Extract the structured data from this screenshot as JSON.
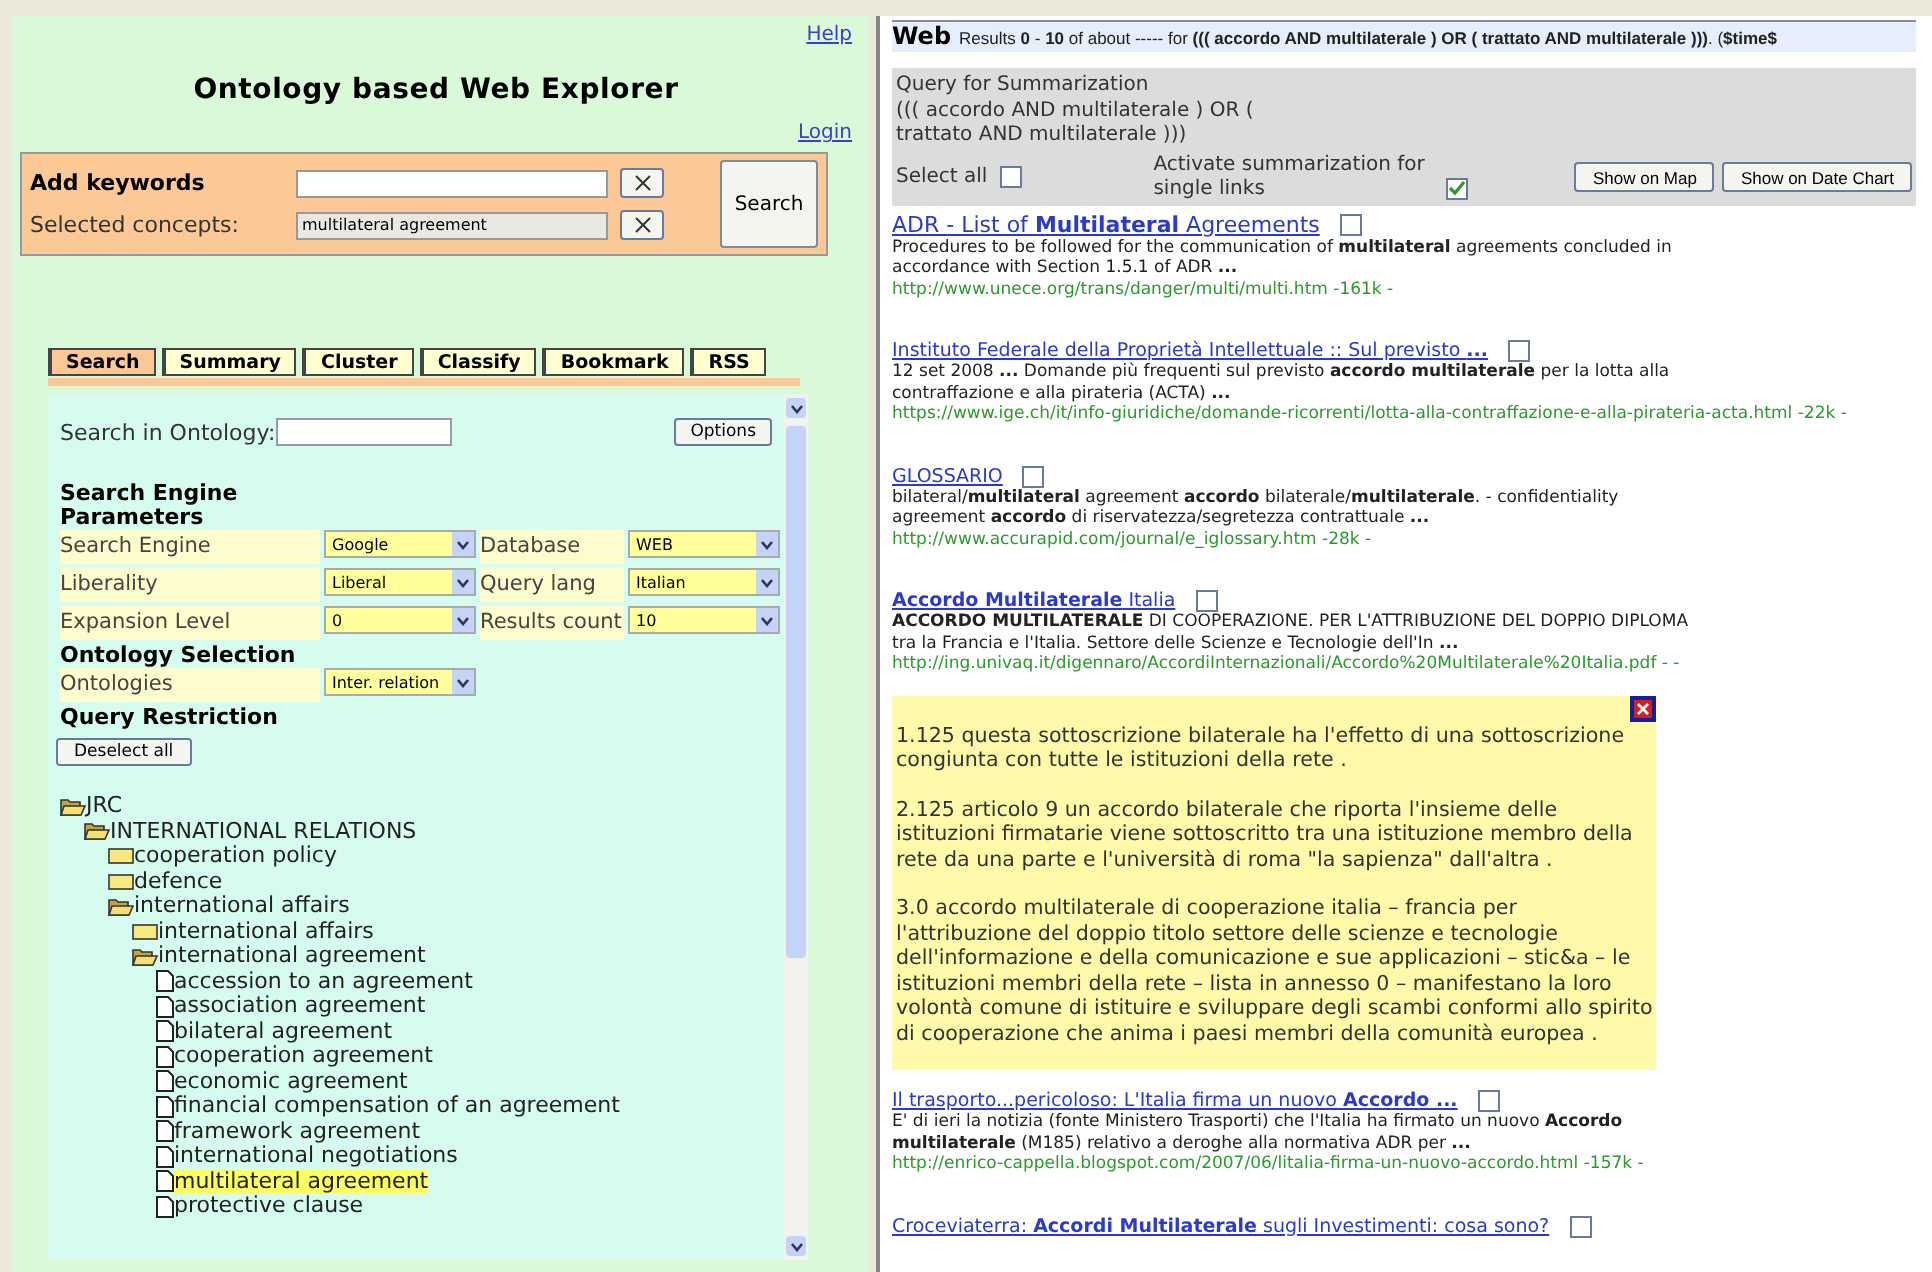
{
  "left": {
    "help_link": "Help",
    "title": "Ontology based Web Explorer",
    "login_link": "Login",
    "keywords": {
      "label": "Add keywords",
      "concepts_label": "Selected concepts:",
      "concepts_value": "multilateral agreement",
      "search_button": "Search"
    },
    "tabs": [
      {
        "label": "Search",
        "selected": true
      },
      {
        "label": "Summary",
        "selected": false
      },
      {
        "label": "Cluster",
        "selected": false
      },
      {
        "label": "Classify",
        "selected": false
      },
      {
        "label": "Bookmark",
        "selected": false
      },
      {
        "label": "RSS",
        "selected": false
      }
    ],
    "search_in_ontology": {
      "label": "Search in Ontology:",
      "options_button": "Options"
    },
    "params_heading": "Search Engine Parameters",
    "params": [
      [
        {
          "label": "Search Engine",
          "value": "Google"
        },
        {
          "label": "Database",
          "value": "WEB"
        }
      ],
      [
        {
          "label": "Liberality",
          "value": "Liberal"
        },
        {
          "label": "Query lang",
          "value": "Italian"
        }
      ],
      [
        {
          "label": "Expansion Level",
          "value": "0"
        },
        {
          "label": "Results count",
          "value": "10"
        }
      ]
    ],
    "ontology_heading": "Ontology Selection",
    "ontologies": {
      "label": "Ontologies",
      "value": "Inter. relation"
    },
    "restriction_heading": "Query Restriction",
    "deselect_button": "Deselect all",
    "tree": [
      {
        "label": "JRC",
        "expanded": true,
        "selected": false,
        "children": [
          {
            "label": "INTERNATIONAL RELATIONS",
            "expanded": true,
            "selected": false,
            "children": [
              {
                "label": "cooperation policy",
                "expanded": false,
                "selected": false
              },
              {
                "label": "defence",
                "expanded": false,
                "selected": false
              },
              {
                "label": "international affairs",
                "expanded": true,
                "selected": false,
                "children": [
                  {
                    "label": "international affairs",
                    "expanded": false,
                    "selected": false
                  },
                  {
                    "label": "international agreement",
                    "expanded": true,
                    "selected": false,
                    "children": [
                      {
                        "label": "accession to an agreement",
                        "kind": "leaf",
                        "selected": false
                      },
                      {
                        "label": "association agreement",
                        "kind": "leaf",
                        "selected": false
                      },
                      {
                        "label": "bilateral agreement",
                        "kind": "leaf",
                        "selected": false
                      },
                      {
                        "label": "cooperation agreement",
                        "kind": "leaf",
                        "selected": false
                      },
                      {
                        "label": "economic agreement",
                        "kind": "leaf",
                        "selected": false
                      },
                      {
                        "label": "financial compensation of an agreement",
                        "kind": "leaf",
                        "selected": false
                      },
                      {
                        "label": "framework agreement",
                        "kind": "leaf",
                        "selected": false
                      },
                      {
                        "label": "international negotiations",
                        "kind": "leaf",
                        "selected": false
                      },
                      {
                        "label": "multilateral agreement",
                        "kind": "leaf",
                        "selected": true
                      },
                      {
                        "label": "protective clause",
                        "kind": "leaf",
                        "selected": false
                      }
                    ]
                  }
                ]
              }
            ]
          }
        ]
      }
    ]
  },
  "right": {
    "header_brand": "Web",
    "header_text": "Results **0** - **10** of about ----- for **((( accordo AND multilaterale ) OR ( trattato AND multilaterale )))**. (**$time$**",
    "summary_box": {
      "title": "Query for Summarization",
      "query": "((( accordo AND multilaterale ) OR ( trattato AND multilaterale )))",
      "select_all": "Select all",
      "select_all_checked": false,
      "activate_label": "Activate summarization for single links",
      "activate_checked": true,
      "buttons": [
        "Show on Map",
        "Show on Date Chart"
      ]
    },
    "results": [
      {
        "kind": "large",
        "title": "ADR - List of **Multilateral** Agreements",
        "checked": false,
        "description": "Procedures to be followed for the communication of **multilateral** agreements concluded in accordance with Section 1.5.1 of ADR **...**",
        "url": "http://www.unece.org/trans/danger/multi/multi.htm -161k -"
      },
      {
        "kind": "small",
        "title": "Instituto Federale della Proprietà Intellettuale :: Sul previsto **...**",
        "checked": false,
        "description": "12 set 2008 **...** Domande più frequenti sul previsto **accordo multilaterale** per la lotta alla contraffazione e alla pirateria (ACTA) **...**",
        "url": "https://www.ige.ch/it/info-giuridiche/domande-ricorrenti/lotta-alla-contraffazione-e-alla-pirateria-acta.html -22k -"
      },
      {
        "kind": "small",
        "title": "GLOSSARIO",
        "checked": false,
        "description": "bilateral/**multilateral** agreement **accordo** bilaterale/**multilaterale**. - confidentiality agreement **accordo** di riservatezza/segretezza contrattuale **...**",
        "url": "http://www.accurapid.com/journal/e_iglossary.htm -28k -"
      },
      {
        "kind": "small",
        "title": "**Accordo Multilaterale** Italia",
        "checked": false,
        "description": "**ACCORDO MULTILATERALE** DI COOPERAZIONE. PER L'ATTRIBUZIONE DEL DOPPIO DIPLOMA tra la Francia e l'Italia. Settore delle Scienze e Tecnologie dell'In **...**",
        "url": "http://ing.univaq.it/digennaro/AccordiInternazionali/Accordo%20Multilaterale%20Italia.pdf - -",
        "summary": [
          "1.125 questa sottoscrizione bilaterale ha l'effetto di una sottoscrizione congiunta con tutte le istituzioni della rete .",
          "2.125 articolo 9 un accordo bilaterale che riporta l'insieme delle istituzioni firmatarie viene sottoscritto tra una istituzione membro della rete da una parte e l'università di roma \"la sapienza\" dall'altra .",
          "3.0 accordo multilaterale di cooperazione italia – francia per l'attribuzione del doppio titolo settore delle scienze e tecnologie dell'informazione e della comunicazione e sue applicazioni – stic&a – le istituzioni membri della rete – lista in annesso 0 – manifestano la loro volontà comune di istituire e sviluppare degli scambi conformi allo spirito di cooperazione che anima i paesi membri della comunità europea ."
        ]
      },
      {
        "kind": "small",
        "title": "Il trasporto...pericoloso: L'Italia firma un nuovo **Accordo ...**",
        "checked": false,
        "description": "E' di ieri la notizia (fonte Ministero Trasporti) che l'Italia ha firmato un nuovo **Accordo multilaterale** (M185) relativo a deroghe alla normativa ADR per **...**",
        "url": "http://enrico-cappella.blogspot.com/2007/06/litalia-firma-un-nuovo-accordo.html -157k -"
      },
      {
        "kind": "small",
        "title": "Croceviaterra: **Accordi Multilaterale** sugli Investimenti: cosa sono?",
        "checked": false
      }
    ]
  }
}
